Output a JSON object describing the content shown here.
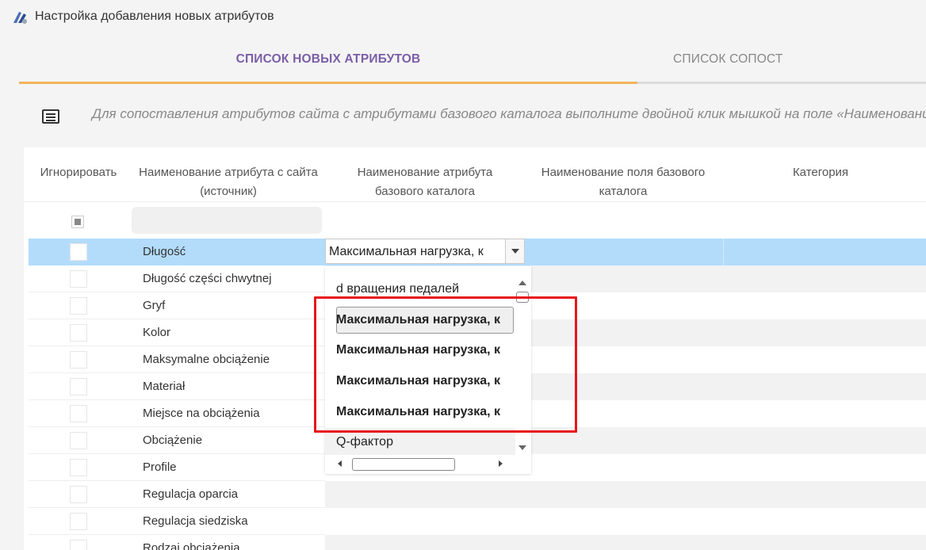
{
  "app": {
    "title": "Настройка добавления новых атрибутов"
  },
  "tabs": [
    {
      "label": "СПИСОК НОВЫХ АТРИБУТОВ",
      "active": true
    },
    {
      "label": "СПИСОК СОПОСТ",
      "active": false
    }
  ],
  "hint": {
    "text": "Для сопоставления атрибутов сайта с атрибутами базового каталога выполните двойной клик мышкой на поле «Наименовани"
  },
  "table": {
    "columns": {
      "ignore": "Игнорировать",
      "source_name": "Наименование атрибута с сайта (источник)",
      "base_attr": "Наименование атрибута базового каталога",
      "base_field": "Наименование поля базового каталога",
      "category": "Категория"
    },
    "rows": [
      {
        "name": "Długość"
      },
      {
        "name": "Długość części chwytnej"
      },
      {
        "name": "Gryf"
      },
      {
        "name": "Kolor"
      },
      {
        "name": "Maksymalne obciążenie"
      },
      {
        "name": "Materiał"
      },
      {
        "name": "Miejsce na obciążenia"
      },
      {
        "name": "Obciążenie"
      },
      {
        "name": "Profile"
      },
      {
        "name": "Regulacja oparcia"
      },
      {
        "name": "Regulacja siedziska"
      },
      {
        "name": "Rodzaj obciążenia"
      }
    ]
  },
  "combo": {
    "value": "Максимальная нагрузка, к"
  },
  "dropdown": {
    "options": [
      "d вращения педалей",
      "Максимальная нагрузка, к",
      "Максимальная нагрузка, к",
      "Максимальная нагрузка, к",
      "Максимальная нагрузка, к",
      "Q-фактор"
    ]
  },
  "colors": {
    "accent_purple": "#7b5ea7",
    "tab_underline": "#f2b45c",
    "selected_row": "#b3dcfb",
    "highlight_box": "#e8161a"
  }
}
